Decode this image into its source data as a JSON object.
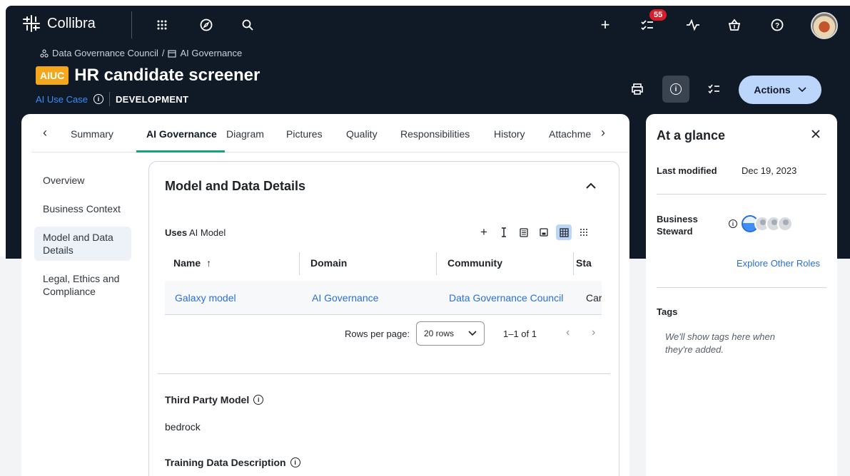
{
  "app": {
    "name": "Collibra",
    "notification_count": "55"
  },
  "breadcrumb": {
    "community": "Data Governance Council",
    "separator": "/",
    "domain": "AI Governance"
  },
  "asset": {
    "type_badge": "AIUC",
    "title": "HR candidate screener",
    "type_label": "AI Use Case",
    "status": "DEVELOPMENT"
  },
  "header": {
    "actions_label": "Actions"
  },
  "tabs": [
    {
      "label": "Summary"
    },
    {
      "label": "AI Governance"
    },
    {
      "label": "Diagram"
    },
    {
      "label": "Pictures"
    },
    {
      "label": "Quality"
    },
    {
      "label": "Responsibilities"
    },
    {
      "label": "History"
    },
    {
      "label": "Attachme"
    }
  ],
  "side_nav": [
    {
      "label": "Overview"
    },
    {
      "label": "Business Context"
    },
    {
      "label": "Model and Data Details"
    },
    {
      "label": "Legal, Ethics and Compliance"
    }
  ],
  "section": {
    "title": "Model and Data Details",
    "uses_label_bold": "Uses",
    "uses_label_rest": " AI Model",
    "table": {
      "columns": [
        "Name",
        "Domain",
        "Community",
        "Sta"
      ],
      "rows": [
        {
          "name": "Galaxy model",
          "domain": "AI Governance",
          "community": "Data Governance Council",
          "status": "Car"
        }
      ]
    },
    "pager": {
      "rows_per_page_label": "Rows per page:",
      "rows_per_page_value": "20 rows",
      "range": "1–1 of 1"
    },
    "fields": [
      {
        "label": "Third Party Model",
        "value": "bedrock"
      },
      {
        "label": "Training Data Description",
        "value": ""
      }
    ]
  },
  "at_a_glance": {
    "title": "At a glance",
    "last_modified_label": "Last modified",
    "last_modified_value": "Dec 19, 2023",
    "steward_label_line1": "Business",
    "steward_label_line2": "Steward",
    "explore_link": "Explore Other Roles",
    "tags_label": "Tags",
    "tags_empty_line1": "We'll show tags here when",
    "tags_empty_line2": "they're added."
  },
  "colors": {
    "brand_dark": "#0f1a26",
    "accent_blue": "#2a6fdb",
    "aiuc_orange": "#f4a71d",
    "tab_green": "#15a37b",
    "badge_red": "#d61f2c"
  }
}
